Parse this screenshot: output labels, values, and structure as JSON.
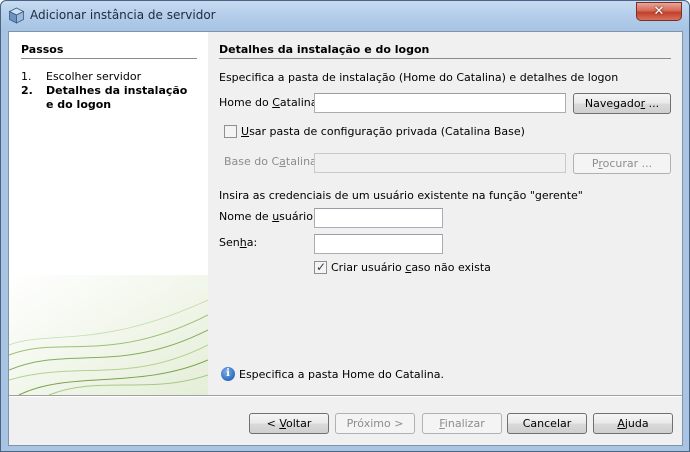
{
  "window": {
    "title": "Adicionar instância de servidor",
    "close_glyph": "✕"
  },
  "steps": {
    "heading": "Passos",
    "items": [
      {
        "number": "1.",
        "label": "Escolher servidor",
        "current": false
      },
      {
        "number": "2.",
        "label": "Detalhes da instalação e do logon",
        "current": true
      }
    ]
  },
  "main": {
    "heading": "Detalhes da instalação e do logon",
    "description": "Especifica a pasta de instalação (Home do Catalina) e detalhes de logon",
    "catalina_home": {
      "label_pre": "Home do ",
      "label_mnemonic": "C",
      "label_post": "atalina:",
      "value": "",
      "browse_pre": "Navegado",
      "browse_mnemonic": "r",
      "browse_post": " ..."
    },
    "private_config": {
      "checked": false,
      "label_mnemonic": "U",
      "label_post": "sar pasta de configuração privada (Catalina Base)"
    },
    "catalina_base": {
      "label_pre": "Base do C",
      "label_mnemonic": "a",
      "label_post": "talina:",
      "value": "",
      "browse_pre": "P",
      "browse_mnemonic": "r",
      "browse_post": "ocurar ..."
    },
    "credentials_text": "Insira as credenciais de um usuário existente na função \"gerente\"",
    "username": {
      "label_pre": "Nome de ",
      "label_mnemonic": "u",
      "label_post": "suário:",
      "value": ""
    },
    "password": {
      "label_pre": "Sen",
      "label_mnemonic": "h",
      "label_post": "a:",
      "value": ""
    },
    "create_user": {
      "checked": true,
      "check_glyph": "✓",
      "label_pre": "Criar usuário ",
      "label_mnemonic": "c",
      "label_post": "aso não exista"
    },
    "info_message": "Especifica a pasta Home do Catalina.",
    "info_icon_glyph": "i"
  },
  "footer": {
    "back": {
      "pre": "< ",
      "mnemonic": "V",
      "post": "oltar",
      "enabled": true
    },
    "next": {
      "pre": "Próximo >",
      "mnemonic": "",
      "post": "",
      "enabled": false
    },
    "finish": {
      "pre": "",
      "mnemonic": "F",
      "post": "inalizar",
      "enabled": false
    },
    "cancel": {
      "pre": "Cancelar",
      "mnemonic": "",
      "post": "",
      "enabled": true
    },
    "help": {
      "pre": "",
      "mnemonic": "A",
      "post": "juda",
      "enabled": true
    }
  },
  "colors": {
    "title_bar": "#b3cdea",
    "close_button": "#c1402b",
    "info_icon": "#2b6cc0",
    "swoosh": "#6e9a3e"
  }
}
